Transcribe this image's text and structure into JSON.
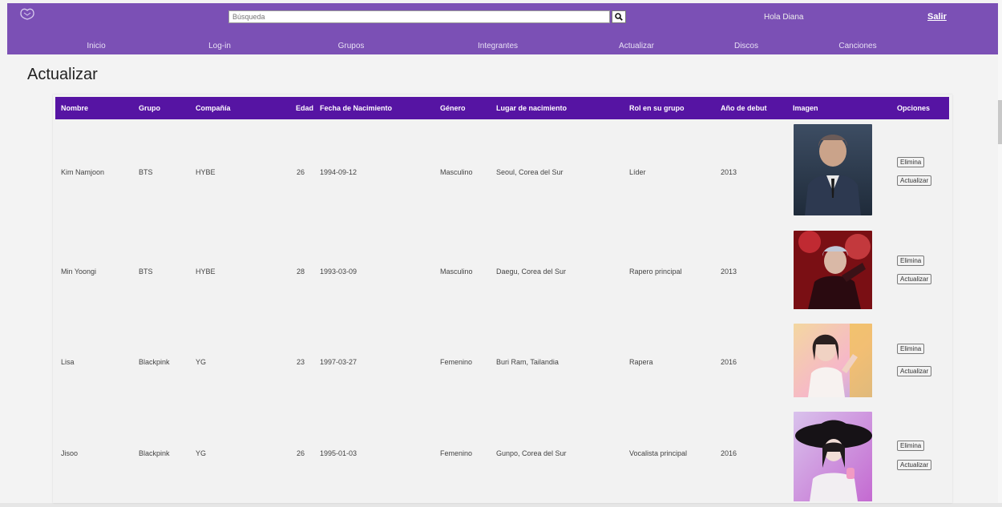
{
  "header": {
    "search_placeholder": "Búsqueda",
    "greeting": "Hola Diana",
    "logout": "Salir",
    "nav": [
      "Inicio",
      "Log-in",
      "Grupos",
      "Integrantes",
      "Actualizar",
      "Discos",
      "Canciones"
    ]
  },
  "page_title": "Actualizar",
  "table": {
    "columns": [
      "Nombre",
      "Grupo",
      "Compañía",
      "Edad",
      "Fecha de Nacimiento",
      "Género",
      "Lugar de nacimiento",
      "Rol en su grupo",
      "Año de debut",
      "Imagen",
      "Opciones"
    ],
    "rows": [
      {
        "nombre": "Kim Namjoon",
        "grupo": "BTS",
        "compania": "HYBE",
        "edad": "26",
        "fecha": "1994-09-12",
        "genero": "Masculino",
        "lugar": "Seoul, Corea del Sur",
        "rol": "Líder",
        "debut": "2013"
      },
      {
        "nombre": "Min Yoongi",
        "grupo": "BTS",
        "compania": "HYBE",
        "edad": "28",
        "fecha": "1993-03-09",
        "genero": "Masculino",
        "lugar": "Daegu, Corea del Sur",
        "rol": "Rapero principal",
        "debut": "2013"
      },
      {
        "nombre": "Lisa",
        "grupo": "Blackpink",
        "compania": "YG",
        "edad": "23",
        "fecha": "1997-03-27",
        "genero": "Femenino",
        "lugar": "Buri Ram, Tailandia",
        "rol": "Rapera",
        "debut": "2016"
      },
      {
        "nombre": "Jisoo",
        "grupo": "Blackpink",
        "compania": "YG",
        "edad": "26",
        "fecha": "1995-01-03",
        "genero": "Femenino",
        "lugar": "Gunpo, Corea del Sur",
        "rol": "Vocalista principal",
        "debut": "2016"
      }
    ],
    "eliminar_label": "Elimina",
    "actualizar_label": "Actualizar"
  },
  "colors": {
    "topbar": "#7b50b5",
    "table_header": "#5614a3"
  }
}
